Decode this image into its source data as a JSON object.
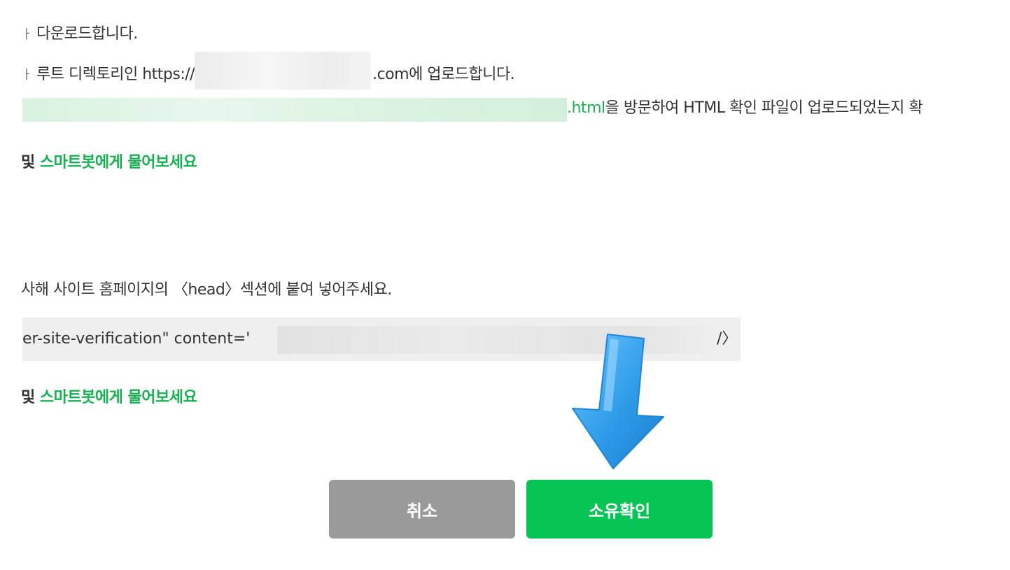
{
  "steps": {
    "download": {
      "mark": "ㅏ",
      "text": "다운로드합니다."
    },
    "upload": {
      "mark": "ㅏ",
      "prefix": "루트 디렉토리인 https://",
      "suffix": ".com에 업로드합니다."
    },
    "visit": {
      "link_suffix": ".html",
      "text": "을 방문하여 HTML 확인 파일이 업로드되었는지 확"
    },
    "help1": {
      "prefix": "및 ",
      "link": "스마트봇에게 물어보세요"
    },
    "meta_instruction": {
      "text": "사해 사이트 홈페이지의 〈head〉섹션에 붙여 넣어주세요."
    },
    "meta_code": {
      "text": "er-site-verification\" content='",
      "close": "/〉"
    },
    "help2": {
      "prefix": "및 ",
      "link": "스마트봇에게 물어보세요"
    }
  },
  "buttons": {
    "cancel": "취소",
    "confirm": "소유확인"
  },
  "colors": {
    "accent_green": "#06c554",
    "link_green": "#19b34f",
    "cancel_gray": "#9a9a9a",
    "arrow_blue": "#2e9be8"
  },
  "icons": {
    "annotation": "down-arrow-icon"
  }
}
